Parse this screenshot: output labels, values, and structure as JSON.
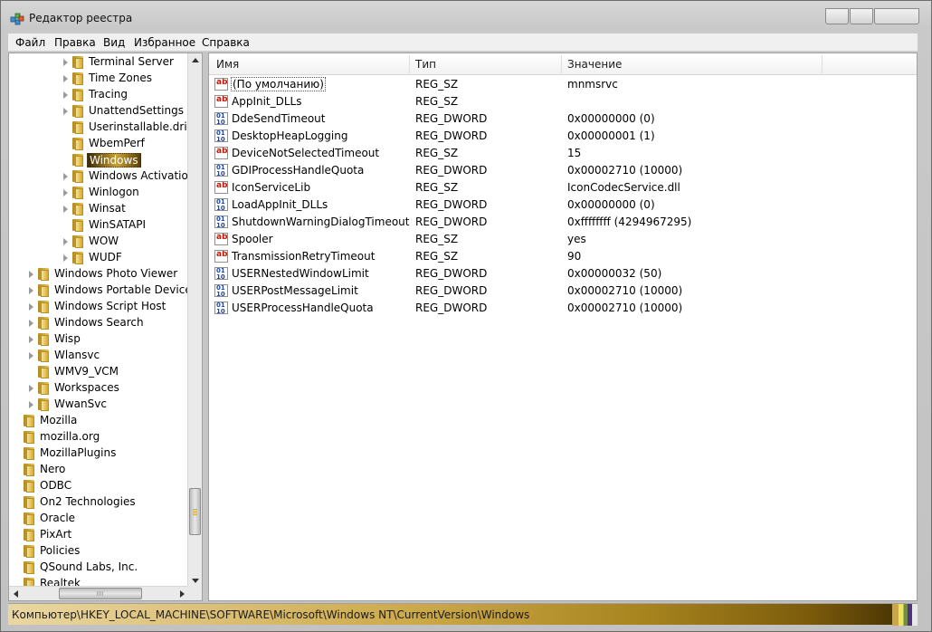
{
  "window": {
    "title": "Редактор реестра"
  },
  "menu": [
    "Файл",
    "Правка",
    "Вид",
    "Избранное",
    "Справка"
  ],
  "tree": [
    {
      "label": "Terminal Server",
      "level": 2,
      "expandable": true
    },
    {
      "label": "Time Zones",
      "level": 2,
      "expandable": true
    },
    {
      "label": "Tracing",
      "level": 2,
      "expandable": true
    },
    {
      "label": "UnattendSettings",
      "level": 2,
      "expandable": true
    },
    {
      "label": "Userinstallable.drivers",
      "level": 2,
      "expandable": false
    },
    {
      "label": "WbemPerf",
      "level": 2,
      "expandable": false
    },
    {
      "label": "Windows",
      "level": 2,
      "expandable": false,
      "selected": true
    },
    {
      "label": "Windows Activation T",
      "level": 2,
      "expandable": true
    },
    {
      "label": "Winlogon",
      "level": 2,
      "expandable": true
    },
    {
      "label": "Winsat",
      "level": 2,
      "expandable": true
    },
    {
      "label": "WinSATAPI",
      "level": 2,
      "expandable": false
    },
    {
      "label": "WOW",
      "level": 2,
      "expandable": true
    },
    {
      "label": "WUDF",
      "level": 2,
      "expandable": true
    },
    {
      "label": "Windows Photo Viewer",
      "level": 1,
      "expandable": true
    },
    {
      "label": "Windows Portable Devices",
      "level": 1,
      "expandable": true
    },
    {
      "label": "Windows Script Host",
      "level": 1,
      "expandable": true
    },
    {
      "label": "Windows Search",
      "level": 1,
      "expandable": true
    },
    {
      "label": "Wisp",
      "level": 1,
      "expandable": true
    },
    {
      "label": "Wlansvc",
      "level": 1,
      "expandable": true
    },
    {
      "label": "WMV9_VCM",
      "level": 1,
      "expandable": false
    },
    {
      "label": "Workspaces",
      "level": 1,
      "expandable": true
    },
    {
      "label": "WwanSvc",
      "level": 1,
      "expandable": true
    },
    {
      "label": "Mozilla",
      "level": 0,
      "expandable": false
    },
    {
      "label": "mozilla.org",
      "level": 0,
      "expandable": false
    },
    {
      "label": "MozillaPlugins",
      "level": 0,
      "expandable": false
    },
    {
      "label": "Nero",
      "level": 0,
      "expandable": false
    },
    {
      "label": "ODBC",
      "level": 0,
      "expandable": false
    },
    {
      "label": "On2 Technologies",
      "level": 0,
      "expandable": false
    },
    {
      "label": "Oracle",
      "level": 0,
      "expandable": false
    },
    {
      "label": "PixArt",
      "level": 0,
      "expandable": false
    },
    {
      "label": "Policies",
      "level": 0,
      "expandable": false
    },
    {
      "label": "QSound Labs, Inc.",
      "level": 0,
      "expandable": false
    },
    {
      "label": "Realtek",
      "level": 0,
      "expandable": false
    }
  ],
  "columns": {
    "name": "Имя",
    "type": "Тип",
    "value": "Значение"
  },
  "values": [
    {
      "name": "(По умолчанию)",
      "type": "REG_SZ",
      "data": "mnmsrvc",
      "icon": "string-value-icon"
    },
    {
      "name": "AppInit_DLLs",
      "type": "REG_SZ",
      "data": "",
      "icon": "string-value-icon"
    },
    {
      "name": "DdeSendTimeout",
      "type": "REG_DWORD",
      "data": "0x00000000 (0)",
      "icon": "binary-value-icon"
    },
    {
      "name": "DesktopHeapLogging",
      "type": "REG_DWORD",
      "data": "0x00000001 (1)",
      "icon": "binary-value-icon"
    },
    {
      "name": "DeviceNotSelectedTimeout",
      "type": "REG_SZ",
      "data": "15",
      "icon": "string-value-icon"
    },
    {
      "name": "GDIProcessHandleQuota",
      "type": "REG_DWORD",
      "data": "0x00002710 (10000)",
      "icon": "binary-value-icon"
    },
    {
      "name": "IconServiceLib",
      "type": "REG_SZ",
      "data": "IconCodecService.dll",
      "icon": "string-value-icon"
    },
    {
      "name": "LoadAppInit_DLLs",
      "type": "REG_DWORD",
      "data": "0x00000000 (0)",
      "icon": "binary-value-icon"
    },
    {
      "name": "ShutdownWarningDialogTimeout",
      "type": "REG_DWORD",
      "data": "0xffffffff (4294967295)",
      "icon": "binary-value-icon"
    },
    {
      "name": "Spooler",
      "type": "REG_SZ",
      "data": "yes",
      "icon": "string-value-icon"
    },
    {
      "name": "TransmissionRetryTimeout",
      "type": "REG_SZ",
      "data": "90",
      "icon": "string-value-icon"
    },
    {
      "name": "USERNestedWindowLimit",
      "type": "REG_DWORD",
      "data": "0x00000032 (50)",
      "icon": "binary-value-icon"
    },
    {
      "name": "USERPostMessageLimit",
      "type": "REG_DWORD",
      "data": "0x00002710 (10000)",
      "icon": "binary-value-icon"
    },
    {
      "name": "USERProcessHandleQuota",
      "type": "REG_DWORD",
      "data": "0x00002710 (10000)",
      "icon": "binary-value-icon"
    }
  ],
  "statusbar": {
    "path": "Компьютер\\HKEY_LOCAL_MACHINE\\SOFTWARE\\Microsoft\\Windows NT\\CurrentVersion\\Windows"
  }
}
